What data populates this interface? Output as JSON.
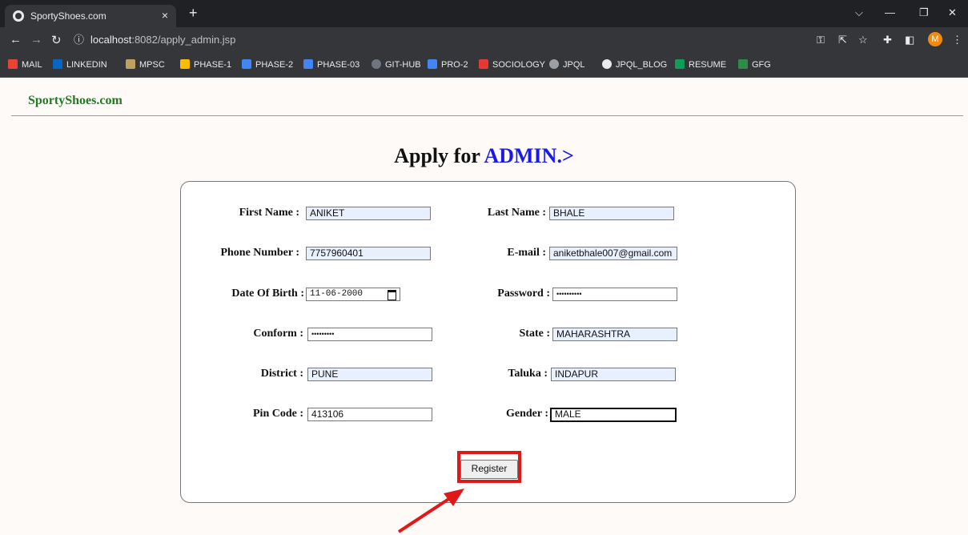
{
  "browser": {
    "tab_title": "SportyShoes.com",
    "tab_close": "×",
    "new_tab": "+",
    "url_host": "localhost",
    "url_rest": ":8082/apply_admin.jsp",
    "avatar_letter": "M",
    "bookmarks": [
      {
        "label": "MAIL",
        "color": "#ea4335"
      },
      {
        "label": "LINKEDIN",
        "color": "#0a66c2"
      },
      {
        "label": "MPSC",
        "color": "#c0a060"
      },
      {
        "label": "PHASE-1",
        "color": "#fbbc04"
      },
      {
        "label": "PHASE-2",
        "color": "#4285f4"
      },
      {
        "label": "PHASE-03",
        "color": "#4285f4"
      },
      {
        "label": "GIT-HUB",
        "color": "#6e7681"
      },
      {
        "label": "PRO-2",
        "color": "#4285f4"
      },
      {
        "label": "SOCIOLOGY",
        "color": "#e53935"
      },
      {
        "label": "JPQL",
        "color": "#9aa0a6"
      },
      {
        "label": "JPQL_BLOG",
        "color": "#e8eaed"
      },
      {
        "label": "RESUME",
        "color": "#0f9d58"
      },
      {
        "label": "GFG",
        "color": "#2f8d46"
      }
    ]
  },
  "page": {
    "brand": "SportyShoes.com",
    "heading_prefix": "Apply for ",
    "heading_accent": "ADMIN.>",
    "form": {
      "first_name_label": "First Name :",
      "first_name_value": "ANIKET",
      "last_name_label": "Last Name :",
      "last_name_value": "BHALE",
      "phone_label": "Phone Number :",
      "phone_value": "7757960401",
      "email_label": "E-mail :",
      "email_value": "aniketbhale007@gmail.com",
      "dob_label": "Date Of Birth :",
      "dob_value": "11-06-2000",
      "password_label": "Password :",
      "password_value": "••••••••••",
      "confirm_label": "Conform :",
      "confirm_value": "•••••••••",
      "state_label": "State :",
      "state_value": "MAHARASHTRA",
      "district_label": "District :",
      "district_value": "PUNE",
      "taluka_label": "Taluka :",
      "taluka_value": "INDAPUR",
      "pincode_label": "Pin Code :",
      "pincode_value": "413106",
      "gender_label": "Gender :",
      "gender_value": "MALE",
      "register_label": "Register"
    }
  },
  "annotation": {
    "color": "#e01818"
  }
}
